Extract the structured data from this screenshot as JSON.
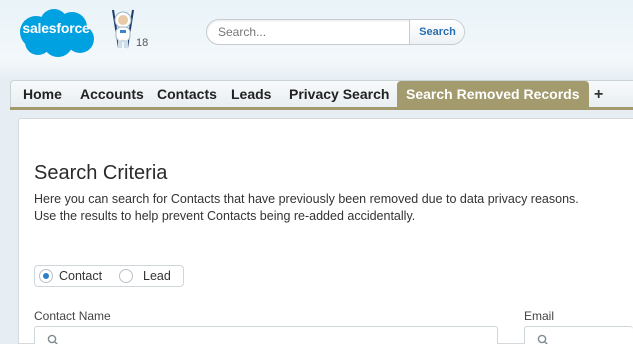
{
  "header": {
    "logo_text": "salesforce",
    "notification_count": "18",
    "search": {
      "placeholder": "Search...",
      "button_label": "Search"
    }
  },
  "tabs": [
    {
      "label": "Home"
    },
    {
      "label": "Accounts"
    },
    {
      "label": "Contacts"
    },
    {
      "label": "Leads"
    },
    {
      "label": "Privacy Search"
    },
    {
      "label": "Search Removed Records",
      "active": true
    },
    {
      "label": "+"
    }
  ],
  "colors": {
    "brand": "#00a1e0",
    "active_tab": "#a39b6e",
    "radio_selected": "#2a7fcf"
  },
  "main": {
    "title": "Search Criteria",
    "description": [
      "Here you can search for Contacts that have previously been removed due to data privacy reasons.",
      "Use the results to help prevent Contacts being re-added accidentally."
    ],
    "record_type": {
      "options": [
        {
          "label": "Contact",
          "selected": true
        },
        {
          "label": "Lead",
          "selected": false
        }
      ]
    },
    "fields": [
      {
        "label": "Contact Name",
        "value": ""
      },
      {
        "label": "Email",
        "value": ""
      }
    ]
  }
}
